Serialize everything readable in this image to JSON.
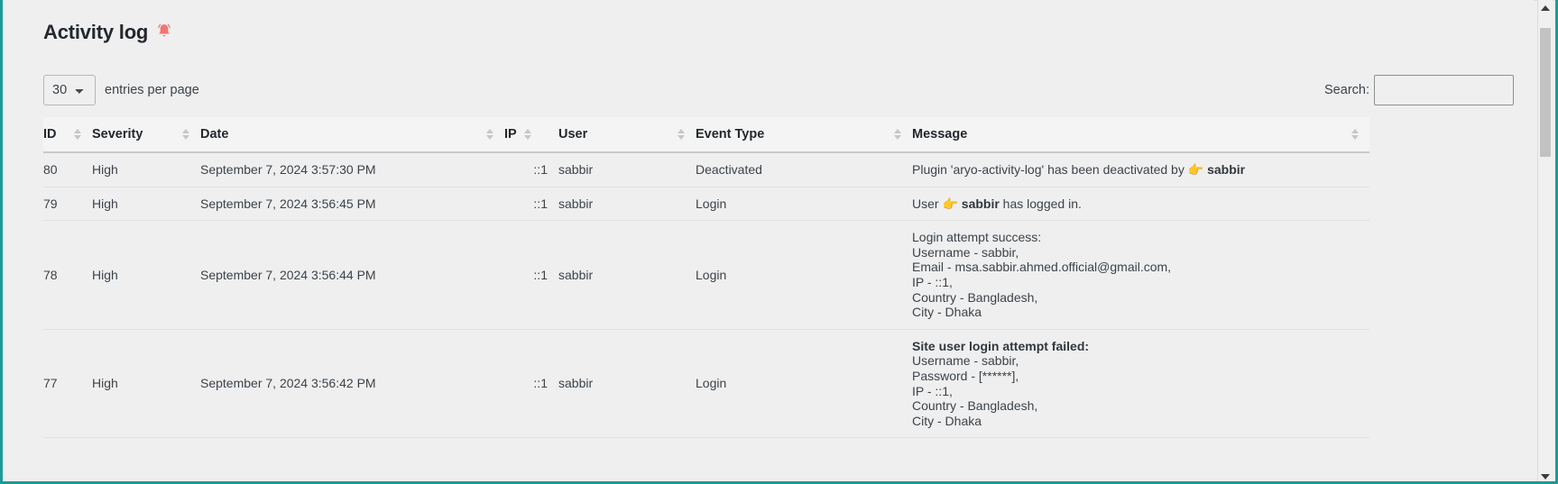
{
  "page": {
    "title": "Activity log",
    "bell_icon": "bell-icon",
    "bell_color": "#f47373"
  },
  "controls": {
    "entries_value": "30",
    "entries_options": [
      "30"
    ],
    "entries_label": "entries per page",
    "search_label": "Search:",
    "search_value": "",
    "search_placeholder": ""
  },
  "table": {
    "columns": [
      {
        "key": "id",
        "label": "ID",
        "sortable": true
      },
      {
        "key": "severity",
        "label": "Severity",
        "sortable": true
      },
      {
        "key": "date",
        "label": "Date",
        "sortable": true
      },
      {
        "key": "ip",
        "label": "IP",
        "sortable": true
      },
      {
        "key": "user",
        "label": "User",
        "sortable": true
      },
      {
        "key": "event_type",
        "label": "Event Type",
        "sortable": true
      },
      {
        "key": "message",
        "label": "Message",
        "sortable": true
      }
    ],
    "rows": [
      {
        "id": "80",
        "severity": "High",
        "date": "September 7, 2024 3:57:30 PM",
        "ip": "::1",
        "user": "sabbir",
        "event_type": "Deactivated",
        "message_prefix": "Plugin 'aryo-activity-log' has been deactivated by ",
        "message_emoji": "👉",
        "message_bold": "sabbir",
        "message_suffix": ""
      },
      {
        "id": "79",
        "severity": "High",
        "date": "September 7, 2024 3:56:45 PM",
        "ip": "::1",
        "user": "sabbir",
        "event_type": "Login",
        "message_prefix": "User ",
        "message_emoji": "👉",
        "message_bold": "sabbir",
        "message_suffix": " has logged in."
      },
      {
        "id": "78",
        "severity": "High",
        "date": "September 7, 2024 3:56:44 PM",
        "ip": "::1",
        "user": "sabbir",
        "event_type": "Login",
        "message_heading": "Login attempt success:",
        "message_heading_bold": false,
        "message_lines": [
          "Username - sabbir,",
          "Email - msa.sabbir.ahmed.official@gmail.com,",
          "IP - ::1,",
          "Country - Bangladesh,",
          "City - Dhaka"
        ]
      },
      {
        "id": "77",
        "severity": "High",
        "date": "September 7, 2024 3:56:42 PM",
        "ip": "::1",
        "user": "sabbir",
        "event_type": "Login",
        "message_heading": "Site user login attempt failed:",
        "message_heading_bold": true,
        "message_lines": [
          "Username - sabbir,",
          "Password - [******],",
          "IP - ::1,",
          "Country - Bangladesh,",
          "City - Dhaka"
        ]
      }
    ]
  },
  "scrollbar": {
    "up_arrow": "scroll-up-arrow",
    "down_arrow": "scroll-down-arrow"
  }
}
